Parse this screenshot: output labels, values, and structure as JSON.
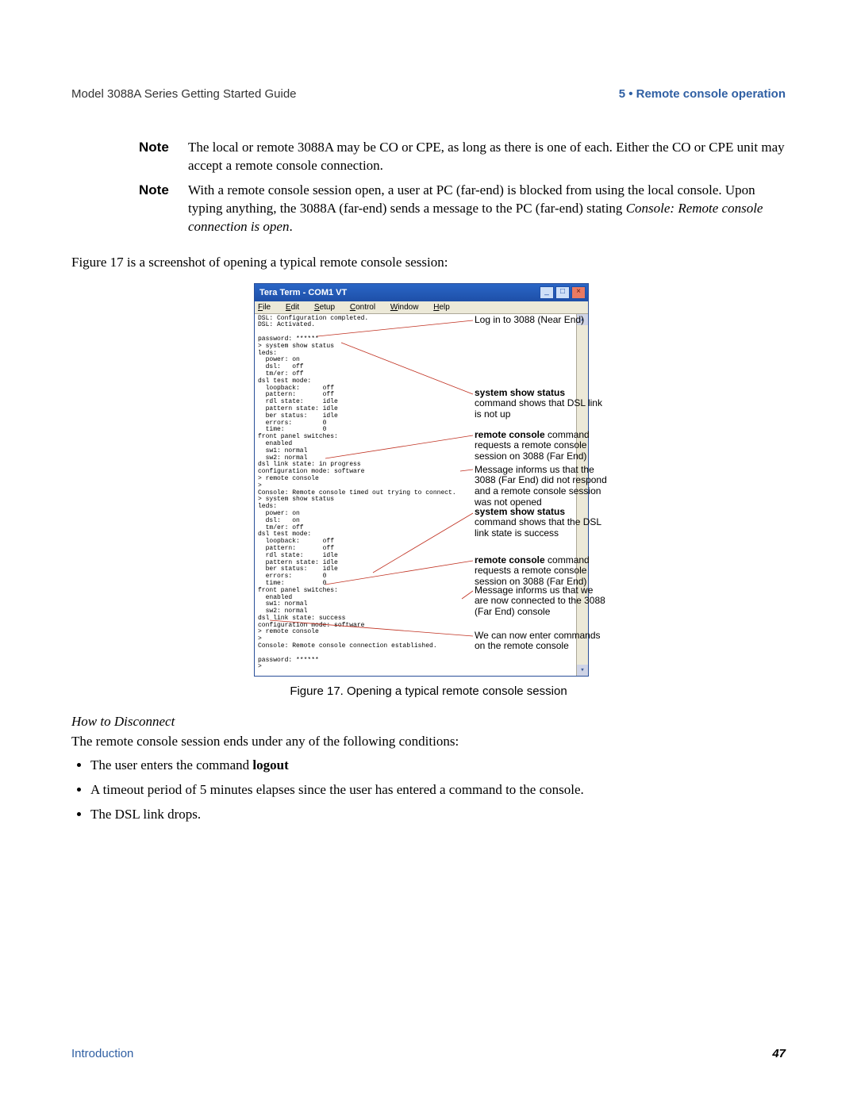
{
  "header": {
    "left": "Model 3088A Series Getting Started Guide",
    "right": "5 • Remote console operation"
  },
  "notes": [
    {
      "label": "Note",
      "body_html": "The local or remote 3088A may be CO or CPE, as long as there is one of each. Either the CO or CPE unit may accept a remote console connection."
    },
    {
      "label": "Note",
      "body_html": "With a remote console session open, a user at PC (far-end) is blocked from using the local console. Upon typing anything, the 3088A (far-end) sends a message to the PC (far-end) stating <em>Console: Remote console connection is open</em>."
    }
  ],
  "intro_para": "Figure 17 is a screenshot of opening a typical remote console session:",
  "terminal": {
    "title": "Tera Term - COM1 VT",
    "menu": [
      "File",
      "Edit",
      "Setup",
      "Control",
      "Window",
      "Help"
    ],
    "lines": "DSL: Configuration completed.\nDSL: Activated.\n\npassword: ******\n> system show status\nleds:\n  power: on\n  dsl:   off\n  tm/er: off\ndsl test mode:\n  loopback:      off\n  pattern:       off\n  rdl state:     idle\n  pattern state: idle\n  ber status:    idle\n  errors:        0\n  time:          0\nfront panel switches:\n  enabled\n  sw1: normal\n  sw2: normal\ndsl link state: in progress\nconfiguration mode: software\n> remote console\n>\nConsole: Remote console timed out trying to connect.\n> system show status\nleds:\n  power: on\n  dsl:   on\n  tm/er: off\ndsl test mode:\n  loopback:      off\n  pattern:       off\n  rdl state:     idle\n  pattern state: idle\n  ber status:    idle\n  errors:        0\n  time:          0\nfront panel switches:\n  enabled\n  sw1: normal\n  sw2: normal\ndsl link state: success\nconfiguration mode: software\n> remote console\n>\nConsole: Remote console connection established.\n\npassword: ******\n>"
  },
  "annotations": [
    {
      "html": "Log in to 3088 (Near End)"
    },
    {
      "html": "<b>system show status</b> command shows that DSL link is not up"
    },
    {
      "html": "<b>remote console</b> command requests a remote console session on 3088 (Far End)"
    },
    {
      "html": "Message informs us that the 3088 (Far End) did not respond and a remote console session was not opened"
    },
    {
      "html": "<b>system show status</b> command shows that the DSL link state is success"
    },
    {
      "html": "<b>remote console</b> command requests a remote console session on 3088 (Far End)"
    },
    {
      "html": "Message informs us that we are now connected to the 3088 (Far End) console"
    },
    {
      "html": "We can now enter commands on the remote console"
    }
  ],
  "figure_caption": "Figure 17. Opening a typical remote console session",
  "disconnect": {
    "heading": "How to Disconnect",
    "intro": "The remote console session ends under any of the following conditions:",
    "items": [
      "The user enters the command <b>logout</b>",
      "A timeout period of 5 minutes elapses since the user has entered a command to the console.",
      "The DSL link drops."
    ]
  },
  "footer": {
    "label": "Introduction",
    "page": "47"
  }
}
